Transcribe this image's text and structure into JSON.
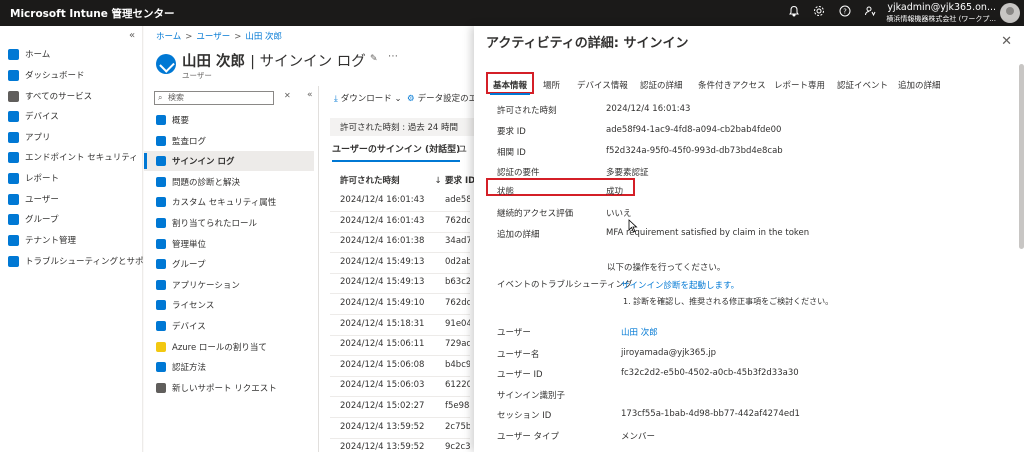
{
  "topbar": {
    "brand": "Microsoft Intune 管理センター",
    "icons": [
      "bell-icon",
      "gear-icon",
      "help-icon",
      "feedback-icon"
    ],
    "account_user": "yjkadmin@yjk365.on...",
    "account_tenant": "横浜情報機器株式会社 (ワークプ..."
  },
  "leftnav": {
    "collapse_label": "«",
    "items": [
      {
        "label": "ホーム",
        "color": "#0078d4"
      },
      {
        "label": "ダッシュボード",
        "color": "#0078d4"
      },
      {
        "label": "すべてのサービス",
        "color": "#605e5c"
      },
      {
        "label": "デバイス",
        "color": "#0078d4"
      },
      {
        "label": "アプリ",
        "color": "#0078d4"
      },
      {
        "label": "エンドポイント セキュリティ",
        "color": "#0078d4"
      },
      {
        "label": "レポート",
        "color": "#0078d4"
      },
      {
        "label": "ユーザー",
        "color": "#0078d4"
      },
      {
        "label": "グループ",
        "color": "#0078d4"
      },
      {
        "label": "テナント管理",
        "color": "#0078d4"
      },
      {
        "label": "トラブルシューティングとサポート",
        "color": "#0078d4"
      }
    ]
  },
  "blade": {
    "breadcrumb": [
      "ホーム",
      "ユーザー",
      "山田 次郎"
    ],
    "title_name": "山田 次郎",
    "title_rest": "| サインイン ログ",
    "subtitle": "ユーザー",
    "search_placeholder": "検索",
    "collapse_label": "«",
    "clear_label": "✕",
    "submenu": [
      {
        "label": "概要",
        "color": "#0078d4"
      },
      {
        "label": "監査ログ",
        "color": "#0078d4"
      },
      {
        "label": "サインイン ログ",
        "color": "#0078d4",
        "selected": true
      },
      {
        "label": "問題の診断と解決",
        "color": "#0078d4"
      },
      {
        "label": "カスタム セキュリティ属性",
        "color": "#0078d4"
      },
      {
        "label": "割り当てられたロール",
        "color": "#0078d4"
      },
      {
        "label": "管理単位",
        "color": "#0078d4"
      },
      {
        "label": "グループ",
        "color": "#0078d4"
      },
      {
        "label": "アプリケーション",
        "color": "#0078d4"
      },
      {
        "label": "ライセンス",
        "color": "#0078d4"
      },
      {
        "label": "デバイス",
        "color": "#0078d4"
      },
      {
        "label": "Azure ロールの割り当て",
        "color": "#f2c811"
      },
      {
        "label": "認証方法",
        "color": "#0078d4"
      },
      {
        "label": "新しいサポート リクエスト",
        "color": "#605e5c"
      }
    ],
    "toolbar": {
      "download": "ダウンロード",
      "export": "データ設定のエ"
    },
    "filter_label": "許可された時刻 : 過去 24 時間",
    "tabs": [
      "ユーザーのサインイン (対話型)",
      "ユ"
    ],
    "col_time": "許可された時刻",
    "col_req": "要求 ID",
    "rows": [
      {
        "time": "2024/12/4 16:01:43",
        "req": "ade58f"
      },
      {
        "time": "2024/12/4 16:01:43",
        "req": "762dc3"
      },
      {
        "time": "2024/12/4 16:01:38",
        "req": "34ad72"
      },
      {
        "time": "2024/12/4 15:49:13",
        "req": "0d2abc"
      },
      {
        "time": "2024/12/4 15:49:13",
        "req": "b63c24"
      },
      {
        "time": "2024/12/4 15:49:10",
        "req": "762dc3"
      },
      {
        "time": "2024/12/4 15:18:31",
        "req": "91e04("
      },
      {
        "time": "2024/12/4 15:06:11",
        "req": "729ac5"
      },
      {
        "time": "2024/12/4 15:06:08",
        "req": "b4bc95"
      },
      {
        "time": "2024/12/4 15:06:03",
        "req": "61220"
      },
      {
        "time": "2024/12/4 15:02:27",
        "req": "f5e984"
      },
      {
        "time": "2024/12/4 13:59:52",
        "req": "2c75b2"
      },
      {
        "time": "2024/12/4 13:59:52",
        "req": "9c2c30"
      }
    ]
  },
  "panel": {
    "title": "アクティビティの詳細: サインイン",
    "close_label": "✕",
    "tabs": [
      "基本情報",
      "場所",
      "デバイス情報",
      "認証の詳細",
      "条件付きアクセス",
      "レポート専用",
      "認証イベント",
      "追加の詳細"
    ],
    "fields": {
      "time_label": "許可された時刻",
      "time_value": "2024/12/4 16:01:43",
      "req_label": "要求 ID",
      "req_value": "ade58f94-1ac9-4fd8-a094-cb2bab4fde00",
      "corr_label": "相関 ID",
      "corr_value": "f52d324a-95f0-45f0-993d-db73bd4e8cab",
      "authreq_label": "認証の要件",
      "authreq_value": "多要素認証",
      "status_label": "状態",
      "status_value": "成功",
      "cae_label": "継続的アクセス評価",
      "cae_value": "いいえ",
      "add_label": "追加の詳細",
      "add_value": "MFA requirement satisfied by claim in the token",
      "ts_intro": "以下の操作を行ってください。",
      "ts_label": "イベントのトラブルシューティング",
      "ts_link": "サインイン診断を起動します。",
      "ts_step": "1. 診断を確認し、推奨される修正事項をご検討ください。",
      "user_label": "ユーザー",
      "user_value": "山田 次郎",
      "uname_label": "ユーザー名",
      "uname_value": "jiroyamada@yjk365.jp",
      "uid_label": "ユーザー ID",
      "uid_value": "fc32c2d2-e5b0-4502-a0cb-45b3f2d33a30",
      "signid_label": "サインイン識別子",
      "sess_label": "セッション ID",
      "sess_value": "173cf55a-1bab-4d98-bb77-442af4274ed1",
      "utype_label": "ユーザー タイプ",
      "utype_value": "メンバー"
    }
  },
  "colors": {
    "accent": "#0078d4",
    "highlight": "#d41f27",
    "topbar": "#1b1a19"
  }
}
